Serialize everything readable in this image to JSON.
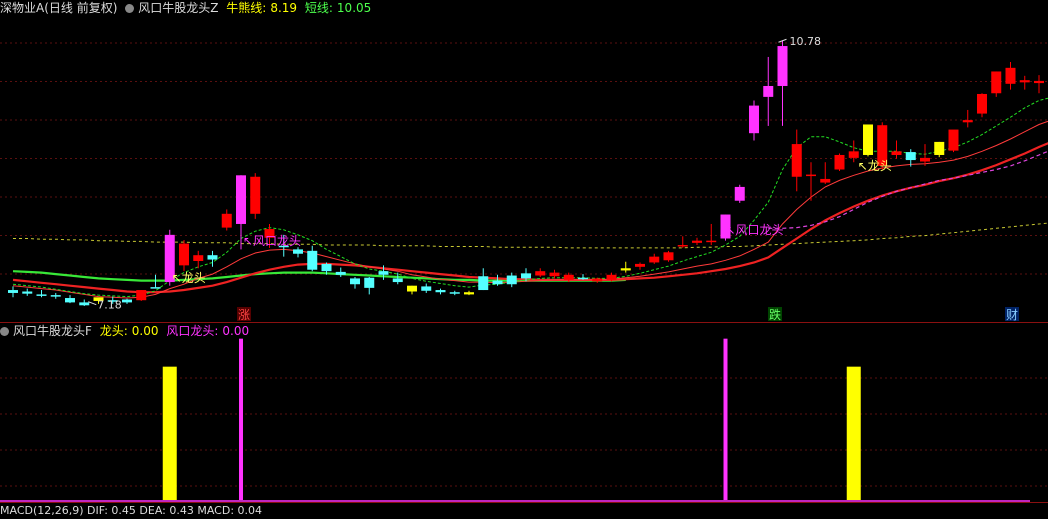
{
  "main_header": {
    "stock": "深物业A(日线 前复权)",
    "indicator": "风口牛股龙头Z",
    "line1_label": "牛熊线:",
    "line1_value": "8.19",
    "line2_label": "短线:",
    "line2_value": "10.05"
  },
  "sub_header": {
    "indicator": "风口牛股龙头F",
    "s1_label": "龙头:",
    "s1_value": "0.00",
    "s2_label": "风口龙头:",
    "s2_value": "0.00"
  },
  "bottom_header": {
    "text": "MACD(12,26,9) DIF: 0.45 DEA: 0.43 MACD: 0.04"
  },
  "annotations": {
    "high": "10.78",
    "low": "7.18",
    "tag_rise": "涨",
    "tag_fall": "跌",
    "tag_money": "财",
    "longtou": "龙头",
    "fengkou": "风口龙头"
  },
  "colors": {
    "up": "#ff0000",
    "down": "#54ffff",
    "limit_up": "#ff33ff",
    "signal": "#ffff00",
    "ma_fast": "#ff3b3b",
    "ma_slow": "#ee2222",
    "bull_bear": "#38e838",
    "yellow_dash": "#c8c832",
    "green_dash": "#22dd22",
    "magenta_dash": "#dd44dd"
  },
  "chart_data": [
    {
      "type": "candlestick",
      "title": "风口牛股龙头Z",
      "ylim": [
        6.9,
        11.1
      ],
      "high_marker": 10.78,
      "low_marker": 7.18,
      "candles": [
        {
          "o": 7.34,
          "h": 7.39,
          "l": 7.24,
          "c": 7.3,
          "k": "down"
        },
        {
          "o": 7.32,
          "h": 7.36,
          "l": 7.26,
          "c": 7.29,
          "k": "down"
        },
        {
          "o": 7.27,
          "h": 7.34,
          "l": 7.24,
          "c": 7.28,
          "k": "down"
        },
        {
          "o": 7.27,
          "h": 7.3,
          "l": 7.22,
          "c": 7.25,
          "k": "down"
        },
        {
          "o": 7.23,
          "h": 7.27,
          "l": 7.16,
          "c": 7.17,
          "k": "down"
        },
        {
          "o": 7.17,
          "h": 7.21,
          "l": 7.12,
          "c": 7.13,
          "k": "down"
        },
        {
          "o": 7.19,
          "h": 7.23,
          "l": 7.15,
          "c": 7.24,
          "k": "signal"
        },
        {
          "o": 7.2,
          "h": 7.25,
          "l": 7.15,
          "c": 7.18,
          "k": "down"
        },
        {
          "o": 7.17,
          "h": 7.22,
          "l": 7.15,
          "c": 7.21,
          "k": "down"
        },
        {
          "o": 7.2,
          "h": 7.34,
          "l": 7.19,
          "c": 7.34,
          "k": "up"
        },
        {
          "o": 7.37,
          "h": 7.55,
          "l": 7.37,
          "c": 7.38,
          "k": "down"
        },
        {
          "o": 7.45,
          "h": 8.17,
          "l": 7.4,
          "c": 8.1,
          "k": "limit"
        },
        {
          "o": 7.98,
          "h": 8.03,
          "l": 7.6,
          "c": 7.68,
          "k": "up"
        },
        {
          "o": 7.82,
          "h": 7.88,
          "l": 7.64,
          "c": 7.74,
          "k": "up"
        },
        {
          "o": 7.76,
          "h": 7.88,
          "l": 7.66,
          "c": 7.82,
          "k": "down"
        },
        {
          "o": 8.2,
          "h": 8.45,
          "l": 8.16,
          "c": 8.39,
          "k": "up"
        },
        {
          "o": 8.25,
          "h": 8.92,
          "l": 7.9,
          "c": 8.92,
          "k": "limit"
        },
        {
          "o": 8.9,
          "h": 8.95,
          "l": 8.32,
          "c": 8.39,
          "k": "up"
        },
        {
          "o": 8.18,
          "h": 8.25,
          "l": 7.92,
          "c": 8.06,
          "k": "up"
        },
        {
          "o": 7.95,
          "h": 8.1,
          "l": 7.8,
          "c": 7.94,
          "k": "down"
        },
        {
          "o": 7.9,
          "h": 7.93,
          "l": 7.79,
          "c": 7.84,
          "k": "down"
        },
        {
          "o": 7.88,
          "h": 7.95,
          "l": 7.6,
          "c": 7.62,
          "k": "down"
        },
        {
          "o": 7.7,
          "h": 7.72,
          "l": 7.55,
          "c": 7.6,
          "k": "down"
        },
        {
          "o": 7.59,
          "h": 7.65,
          "l": 7.52,
          "c": 7.55,
          "k": "down"
        },
        {
          "o": 7.42,
          "h": 7.52,
          "l": 7.36,
          "c": 7.5,
          "k": "down"
        },
        {
          "o": 7.37,
          "h": 7.52,
          "l": 7.28,
          "c": 7.51,
          "k": "down"
        },
        {
          "o": 7.6,
          "h": 7.68,
          "l": 7.48,
          "c": 7.55,
          "k": "down"
        },
        {
          "o": 7.5,
          "h": 7.58,
          "l": 7.42,
          "c": 7.45,
          "k": "down"
        },
        {
          "o": 7.32,
          "h": 7.4,
          "l": 7.28,
          "c": 7.4,
          "k": "signal"
        },
        {
          "o": 7.39,
          "h": 7.43,
          "l": 7.3,
          "c": 7.33,
          "k": "down"
        },
        {
          "o": 7.34,
          "h": 7.36,
          "l": 7.28,
          "c": 7.31,
          "k": "down"
        },
        {
          "o": 7.31,
          "h": 7.33,
          "l": 7.27,
          "c": 7.3,
          "k": "down"
        },
        {
          "o": 7.28,
          "h": 7.33,
          "l": 7.27,
          "c": 7.31,
          "k": "signal"
        },
        {
          "o": 7.34,
          "h": 7.64,
          "l": 7.34,
          "c": 7.53,
          "k": "down"
        },
        {
          "o": 7.47,
          "h": 7.55,
          "l": 7.4,
          "c": 7.42,
          "k": "down"
        },
        {
          "o": 7.42,
          "h": 7.58,
          "l": 7.38,
          "c": 7.54,
          "k": "down"
        },
        {
          "o": 7.5,
          "h": 7.64,
          "l": 7.46,
          "c": 7.57,
          "k": "down"
        },
        {
          "o": 7.6,
          "h": 7.64,
          "l": 7.52,
          "c": 7.54,
          "k": "up"
        },
        {
          "o": 7.58,
          "h": 7.62,
          "l": 7.5,
          "c": 7.53,
          "k": "up"
        },
        {
          "o": 7.55,
          "h": 7.58,
          "l": 7.45,
          "c": 7.48,
          "k": "up"
        },
        {
          "o": 7.5,
          "h": 7.56,
          "l": 7.48,
          "c": 7.51,
          "k": "down"
        },
        {
          "o": 7.46,
          "h": 7.51,
          "l": 7.44,
          "c": 7.5,
          "k": "up"
        },
        {
          "o": 7.55,
          "h": 7.58,
          "l": 7.46,
          "c": 7.48,
          "k": "up"
        },
        {
          "o": 7.61,
          "h": 7.73,
          "l": 7.58,
          "c": 7.64,
          "k": "signal"
        },
        {
          "o": 7.66,
          "h": 7.72,
          "l": 7.62,
          "c": 7.7,
          "k": "up"
        },
        {
          "o": 7.8,
          "h": 7.84,
          "l": 7.7,
          "c": 7.72,
          "k": "up"
        },
        {
          "o": 7.86,
          "h": 7.88,
          "l": 7.73,
          "c": 7.75,
          "k": "up"
        },
        {
          "o": 7.94,
          "h": 8.08,
          "l": 7.92,
          "c": 7.96,
          "k": "up"
        },
        {
          "o": 7.99,
          "h": 8.06,
          "l": 7.96,
          "c": 8.02,
          "k": "up"
        },
        {
          "o": 8.0,
          "h": 8.25,
          "l": 7.96,
          "c": 8.02,
          "k": "up"
        },
        {
          "o": 8.05,
          "h": 8.38,
          "l": 8.02,
          "c": 8.38,
          "k": "limit"
        },
        {
          "o": 8.57,
          "h": 8.79,
          "l": 8.54,
          "c": 8.76,
          "k": "limit"
        },
        {
          "o": 9.5,
          "h": 9.95,
          "l": 9.4,
          "c": 9.88,
          "k": "limit"
        },
        {
          "o": 10.0,
          "h": 10.55,
          "l": 9.6,
          "c": 10.15,
          "k": "limit"
        },
        {
          "o": 10.15,
          "h": 10.78,
          "l": 9.6,
          "c": 10.7,
          "k": "limit"
        },
        {
          "o": 9.35,
          "h": 9.55,
          "l": 8.7,
          "c": 8.9,
          "k": "up"
        },
        {
          "o": 8.93,
          "h": 9.1,
          "l": 8.57,
          "c": 8.93,
          "k": "up"
        },
        {
          "o": 8.87,
          "h": 9.1,
          "l": 8.8,
          "c": 8.82,
          "k": "up"
        },
        {
          "o": 9.0,
          "h": 9.22,
          "l": 8.98,
          "c": 9.2,
          "k": "up"
        },
        {
          "o": 9.16,
          "h": 9.4,
          "l": 9.1,
          "c": 9.25,
          "k": "up"
        },
        {
          "o": 9.2,
          "h": 9.62,
          "l": 9.18,
          "c": 9.62,
          "k": "signal"
        },
        {
          "o": 9.61,
          "h": 9.65,
          "l": 9.0,
          "c": 9.05,
          "k": "up"
        },
        {
          "o": 9.25,
          "h": 9.4,
          "l": 9.15,
          "c": 9.2,
          "k": "up"
        },
        {
          "o": 9.13,
          "h": 9.28,
          "l": 9.04,
          "c": 9.24,
          "k": "down"
        },
        {
          "o": 9.16,
          "h": 9.35,
          "l": 9.05,
          "c": 9.11,
          "k": "up"
        },
        {
          "o": 9.2,
          "h": 9.38,
          "l": 9.17,
          "c": 9.38,
          "k": "signal"
        },
        {
          "o": 9.26,
          "h": 9.5,
          "l": 9.24,
          "c": 9.55,
          "k": "up"
        },
        {
          "o": 9.65,
          "h": 9.82,
          "l": 9.58,
          "c": 9.68,
          "k": "up"
        },
        {
          "o": 9.77,
          "h": 10.05,
          "l": 9.72,
          "c": 10.04,
          "k": "up"
        },
        {
          "o": 10.05,
          "h": 10.35,
          "l": 10.0,
          "c": 10.35,
          "k": "up"
        },
        {
          "o": 10.4,
          "h": 10.48,
          "l": 10.1,
          "c": 10.18,
          "k": "up"
        },
        {
          "o": 10.23,
          "h": 10.29,
          "l": 10.1,
          "c": 10.2,
          "k": "up"
        },
        {
          "o": 10.19,
          "h": 10.3,
          "l": 10.05,
          "c": 10.22,
          "k": "up"
        },
        {
          "o": 10.35,
          "h": 10.52,
          "l": 9.9,
          "c": 9.93,
          "k": "up"
        },
        {
          "o": 10.18,
          "h": 10.38,
          "l": 9.98,
          "c": 10.28,
          "k": "up"
        },
        {
          "o": 10.16,
          "h": 10.36,
          "l": 9.73,
          "c": 9.73,
          "k": "up"
        }
      ],
      "ma_fast": [
        7.4,
        7.38,
        7.36,
        7.34,
        7.31,
        7.28,
        7.25,
        7.24,
        7.23,
        7.24,
        7.28,
        7.36,
        7.42,
        7.5,
        7.56,
        7.66,
        7.77,
        7.85,
        7.89,
        7.9,
        7.88,
        7.85,
        7.8,
        7.75,
        7.7,
        7.66,
        7.63,
        7.6,
        7.55,
        7.52,
        7.49,
        7.47,
        7.45,
        7.45,
        7.44,
        7.45,
        7.46,
        7.47,
        7.48,
        7.48,
        7.48,
        7.48,
        7.49,
        7.51,
        7.53,
        7.56,
        7.59,
        7.63,
        7.67,
        7.7,
        7.75,
        7.81,
        7.9,
        8.0,
        8.25,
        8.45,
        8.62,
        8.76,
        8.85,
        8.92,
        8.98,
        9.02,
        9.05,
        9.07,
        9.08,
        9.1,
        9.13,
        9.18,
        9.25,
        9.33,
        9.42,
        9.52,
        9.62,
        9.69,
        9.78,
        9.85
      ],
      "ma_slow": [
        7.48,
        7.46,
        7.44,
        7.42,
        7.4,
        7.38,
        7.36,
        7.34,
        7.32,
        7.31,
        7.31,
        7.32,
        7.34,
        7.37,
        7.4,
        7.45,
        7.51,
        7.57,
        7.62,
        7.66,
        7.69,
        7.7,
        7.7,
        7.69,
        7.68,
        7.66,
        7.64,
        7.62,
        7.6,
        7.58,
        7.56,
        7.54,
        7.52,
        7.51,
        7.5,
        7.49,
        7.49,
        7.48,
        7.48,
        7.48,
        7.48,
        7.48,
        7.48,
        7.49,
        7.5,
        7.51,
        7.53,
        7.55,
        7.57,
        7.6,
        7.63,
        7.67,
        7.72,
        7.79,
        7.92,
        8.05,
        8.18,
        8.3,
        8.4,
        8.49,
        8.57,
        8.64,
        8.7,
        8.75,
        8.79,
        8.84,
        8.88,
        8.93,
        8.99,
        9.06,
        9.14,
        9.22,
        9.31,
        9.39,
        9.47,
        9.55
      ],
      "bull_bear_line": [
        7.6,
        7.59,
        7.58,
        7.56,
        7.54,
        7.52,
        7.5,
        7.49,
        7.48,
        7.47,
        7.47,
        7.47,
        7.48,
        7.49,
        7.5,
        7.52,
        7.54,
        7.56,
        7.57,
        7.58,
        7.58,
        7.58,
        7.57,
        7.56,
        7.55,
        7.54,
        7.53,
        7.52,
        7.51,
        7.5,
        7.49,
        7.48,
        7.48,
        7.47,
        7.47,
        7.47,
        7.47,
        7.47,
        7.47,
        7.47,
        7.47,
        7.47,
        7.47,
        7.48
      ],
      "short_line": [
        7.42,
        7.4,
        7.38,
        7.35,
        7.32,
        7.29,
        7.27,
        7.26,
        7.25,
        7.27,
        7.33,
        7.47,
        7.58,
        7.66,
        7.72,
        7.86,
        8.05,
        8.15,
        8.2,
        8.17,
        8.1,
        8.02,
        7.9,
        7.8,
        7.7,
        7.63,
        7.6,
        7.56,
        7.5,
        7.46,
        7.43,
        7.4,
        7.38,
        7.41,
        7.42,
        7.45,
        7.48,
        7.5,
        7.51,
        7.51,
        7.51,
        7.5,
        7.5,
        7.53,
        7.57,
        7.62,
        7.67,
        7.74,
        7.8,
        7.86,
        7.96,
        8.08,
        8.3,
        8.55,
        9.0,
        9.3,
        9.45,
        9.45,
        9.38,
        9.3,
        9.25,
        9.25,
        9.25,
        9.22,
        9.21,
        9.25,
        9.3,
        9.38,
        9.48,
        9.6,
        9.72,
        9.85,
        9.95,
        10.0,
        10.05,
        10.05
      ],
      "magenta_line": [
        8.19,
        8.19,
        8.2,
        8.23,
        8.28,
        8.35,
        8.45,
        8.55,
        8.63,
        8.7,
        8.75,
        8.8,
        8.85,
        8.88,
        8.92,
        8.96,
        9.0,
        9.05,
        9.12,
        9.2,
        9.28,
        9.35,
        9.45
      ],
      "magenta_start_index": 53,
      "yellow_dashed_line": [
        8.05,
        8.05,
        8.04,
        8.04,
        8.03,
        8.03,
        8.02,
        8.02,
        8.01,
        8.01,
        8.0,
        8.0,
        8.0,
        7.99,
        7.99,
        7.99,
        7.98,
        7.98,
        7.98,
        7.97,
        7.97,
        7.97,
        7.96,
        7.96,
        7.96,
        7.96,
        7.95,
        7.95,
        7.95,
        7.95,
        7.94,
        7.94,
        7.94,
        7.94,
        7.93,
        7.93,
        7.93,
        7.93,
        7.93,
        7.92,
        7.92,
        7.92,
        7.92,
        7.92,
        7.92,
        7.92,
        7.92,
        7.92,
        7.93,
        7.93,
        7.94,
        7.94,
        7.95,
        7.96,
        7.97,
        7.98,
        7.99,
        8.0,
        8.01,
        8.02,
        8.03,
        8.05,
        8.06,
        8.08,
        8.09,
        8.11,
        8.13,
        8.15,
        8.17,
        8.19,
        8.21,
        8.23,
        8.25,
        8.27,
        8.29,
        8.31
      ]
    },
    {
      "type": "bar",
      "title": "风口牛股龙头F",
      "series": [
        {
          "name": "龙头",
          "bars": [
            {
              "index": 11,
              "value": 1
            },
            {
              "index": 59,
              "value": 1
            }
          ]
        },
        {
          "name": "风口龙头",
          "bars": [
            {
              "index": 16,
              "value": 1
            },
            {
              "index": 50,
              "value": 1
            }
          ]
        }
      ],
      "ylim": [
        0,
        1.2
      ]
    }
  ]
}
